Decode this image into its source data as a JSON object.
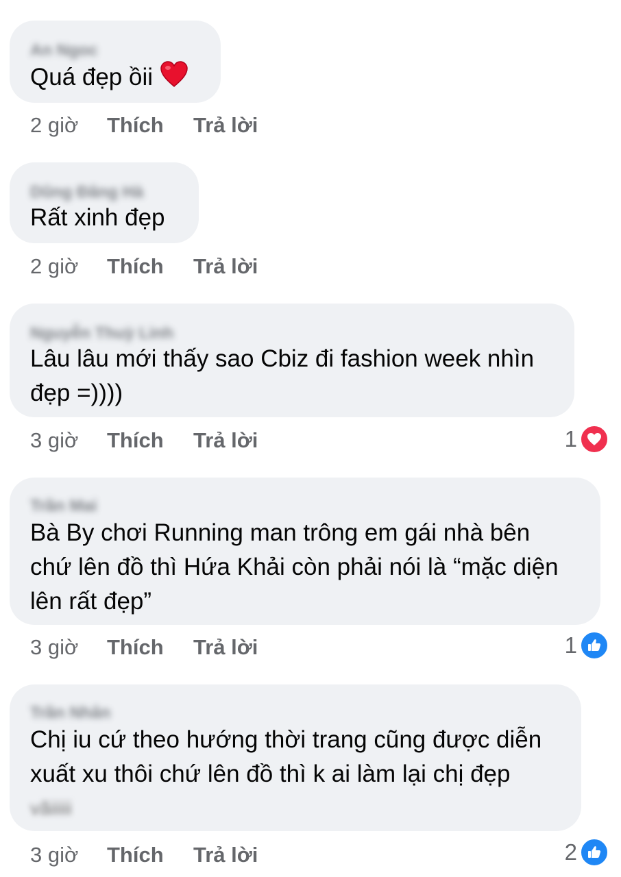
{
  "comments": [
    {
      "author": "An Ngoc",
      "lines": [
        "Quá đẹp ồii"
      ],
      "emoji": "red-heart",
      "time": "2 giờ",
      "like_label": "Thích",
      "reply_label": "Trả lời"
    },
    {
      "author": "Dũng Đăng Hà",
      "lines": [
        "Rất xinh đẹp"
      ],
      "time": "2 giờ",
      "like_label": "Thích",
      "reply_label": "Trả lời"
    },
    {
      "author": "Nguyễn Thuỳ Linh",
      "lines": [
        "Lâu lâu mới thấy sao Cbiz đi fashion week nhìn",
        "đẹp =))))"
      ],
      "time": "3 giờ",
      "like_label": "Thích",
      "reply_label": "Trả lời",
      "reaction": {
        "count": "1",
        "type": "love",
        "icon": "heart-icon"
      }
    },
    {
      "author": "Trần Mai",
      "lines": [
        "Bà By chơi Running man trông em gái nhà bên",
        "chứ lên đồ thì Hứa Khải còn phải nói là “mặc diện",
        "lên rất đẹp”"
      ],
      "time": "3 giờ",
      "like_label": "Thích",
      "reply_label": "Trả lời",
      "reaction": {
        "count": "1",
        "type": "like",
        "icon": "thumbs-up-icon"
      }
    },
    {
      "author": "Trần Nhân",
      "lines": [
        "Chị iu cứ theo hướng thời trang cũng được diễn",
        "xuất xu thôi chứ lên đồ thì k ai làm lại chị đẹp",
        "vãiiiii"
      ],
      "time": "3 giờ",
      "like_label": "Thích",
      "reply_label": "Trả lời",
      "reaction": {
        "count": "2",
        "type": "like",
        "icon": "thumbs-up-icon"
      }
    }
  ],
  "colors": {
    "bubble": "#eff1f4",
    "meta_text": "#65676b",
    "love": "#f0304f",
    "like": "#1f87f5"
  }
}
